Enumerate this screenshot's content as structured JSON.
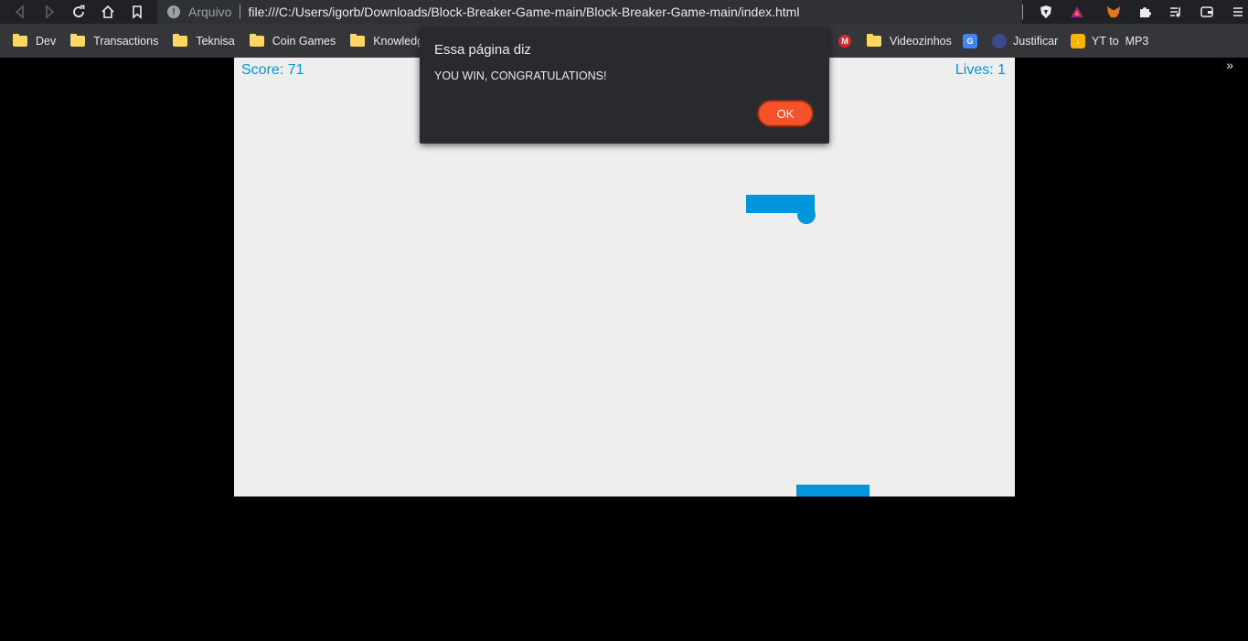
{
  "browser": {
    "omnibox": {
      "scheme_label": "Arquivo",
      "url": "file:///C:/Users/igorb/Downloads/Block-Breaker-Game-main/Block-Breaker-Game-main/index.html"
    },
    "extensions": [
      "brave-shield-icon",
      "brave-rewards-icon",
      "metamask-icon",
      "puzzle-icon",
      "media-icon",
      "wallet-icon",
      "menu-icon"
    ],
    "bookmarks": [
      {
        "label": "Dev",
        "type": "folder"
      },
      {
        "label": "Transactions",
        "type": "folder"
      },
      {
        "label": "Teknisa",
        "type": "folder"
      },
      {
        "label": "Coin Games",
        "type": "folder"
      },
      {
        "label": "Knowledge",
        "type": "folder"
      },
      {
        "label": "Videozinhos",
        "type": "folder"
      },
      {
        "label": "Justificar",
        "type": "link"
      },
      {
        "label": "YT to  MP3",
        "type": "link"
      }
    ]
  },
  "game": {
    "score_text": "Score: 71",
    "lives_text": "Lives: 1",
    "color": "#0095dd"
  },
  "dialog": {
    "title": "Essa página diz",
    "message": "YOU WIN, CONGRATULATIONS!",
    "ok_label": "OK"
  }
}
